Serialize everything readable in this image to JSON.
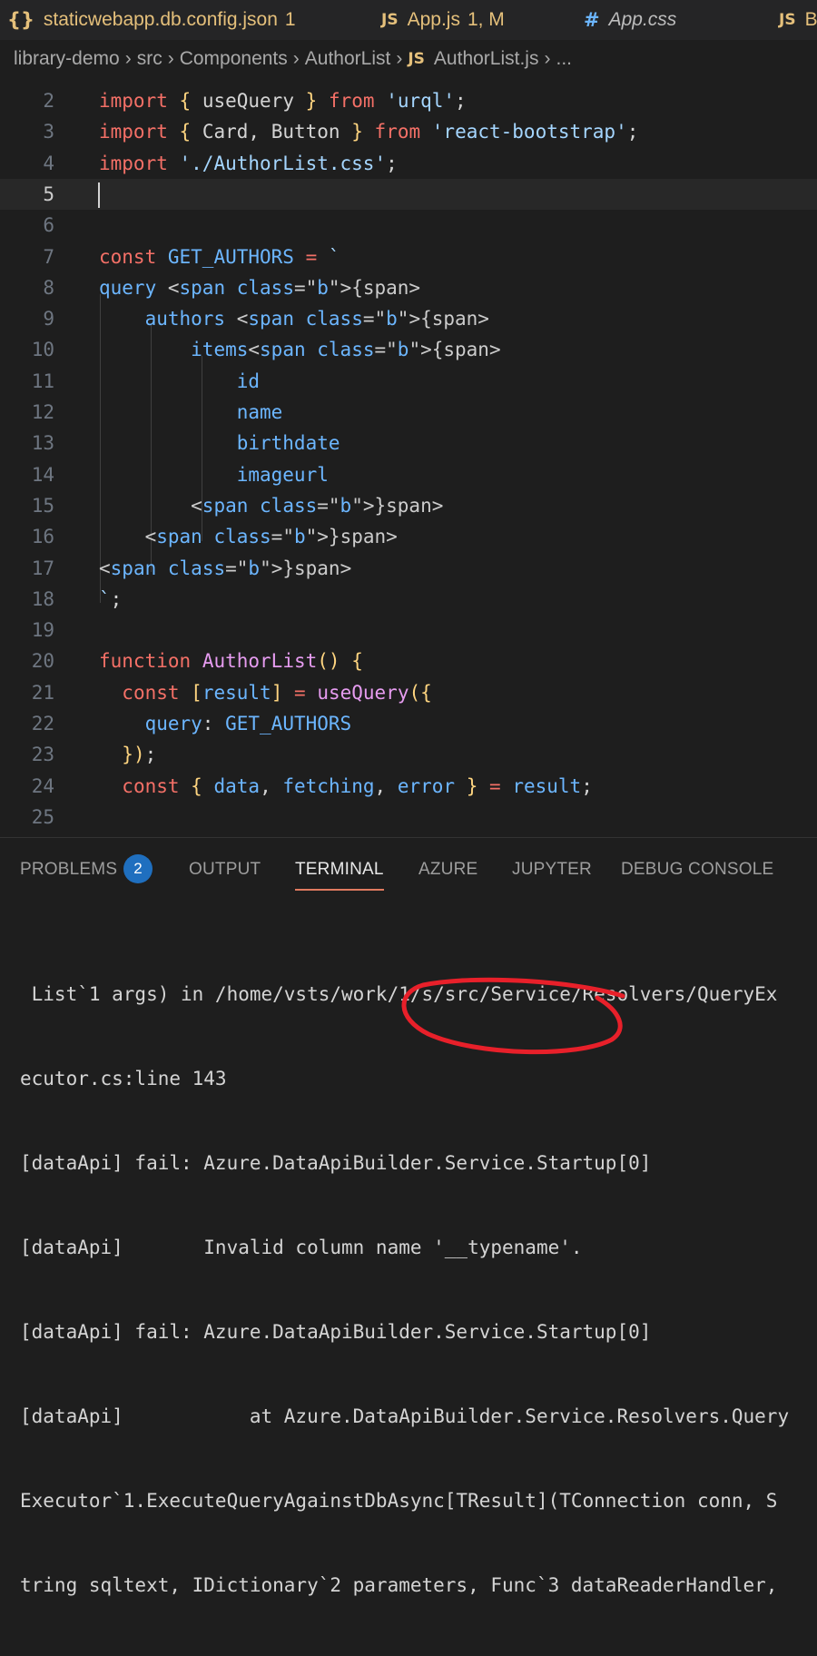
{
  "tabs": [
    {
      "icon": "{}",
      "label": "staticwebapp.db.config.json",
      "status": "1"
    },
    {
      "icon": "JS",
      "label": "App.js",
      "status": "1, M"
    },
    {
      "icon": "#",
      "label": "App.css",
      "status": ""
    },
    {
      "icon": "JS",
      "label": "B",
      "status": ""
    }
  ],
  "breadcrumb": [
    "library-demo",
    "src",
    "Components",
    "AuthorList",
    "AuthorList.js",
    "..."
  ],
  "editor": {
    "lines": [
      {
        "n": "2",
        "text": "import { useQuery } from 'urql';"
      },
      {
        "n": "3",
        "text": "import { Card, Button } from 'react-bootstrap';"
      },
      {
        "n": "4",
        "text": "import './AuthorList.css';"
      },
      {
        "n": "5",
        "text": ""
      },
      {
        "n": "6",
        "text": ""
      },
      {
        "n": "7",
        "text": "const GET_AUTHORS = `"
      },
      {
        "n": "8",
        "text": "query {"
      },
      {
        "n": "9",
        "text": "    authors {"
      },
      {
        "n": "10",
        "text": "        items{"
      },
      {
        "n": "11",
        "text": "            id"
      },
      {
        "n": "12",
        "text": "            name"
      },
      {
        "n": "13",
        "text": "            birthdate"
      },
      {
        "n": "14",
        "text": "            imageurl"
      },
      {
        "n": "15",
        "text": "        }"
      },
      {
        "n": "16",
        "text": "    }"
      },
      {
        "n": "17",
        "text": "}"
      },
      {
        "n": "18",
        "text": "`;"
      },
      {
        "n": "19",
        "text": ""
      },
      {
        "n": "20",
        "text": "function AuthorList() {"
      },
      {
        "n": "21",
        "text": "  const [result] = useQuery({"
      },
      {
        "n": "22",
        "text": "    query: GET_AUTHORS"
      },
      {
        "n": "23",
        "text": "  });"
      },
      {
        "n": "24",
        "text": "  const { data, fetching, error } = result;"
      },
      {
        "n": "25",
        "text": ""
      }
    ]
  },
  "panel": {
    "tabs": [
      "PROBLEMS",
      "OUTPUT",
      "TERMINAL",
      "AZURE",
      "JUPYTER",
      "DEBUG CONSOLE"
    ],
    "active_tab": "TERMINAL",
    "problems_count": "2"
  },
  "terminal": {
    "lines": [
      " List`1 args) in /home/vsts/work/1/s/src/Service/Resolvers/QueryEx",
      "ecutor.cs:line 143",
      "[dataApi] fail: Azure.DataApiBuilder.Service.Startup[0]",
      "[dataApi]       Invalid column name '__typename'.",
      "[dataApi] fail: Azure.DataApiBuilder.Service.Startup[0]",
      "[dataApi]           at Azure.DataApiBuilder.Service.Resolvers.Query",
      "Executor`1.ExecuteQueryAgainstDbAsync[TResult](TConnection conn, S",
      "tring sqltext, IDictionary`2 parameters, Func`3 dataReaderHandler,"
    ]
  },
  "colors": {
    "annotation": "#e8202a",
    "active_tab_underline": "#e07a5f",
    "badge": "#1f6fbf"
  }
}
